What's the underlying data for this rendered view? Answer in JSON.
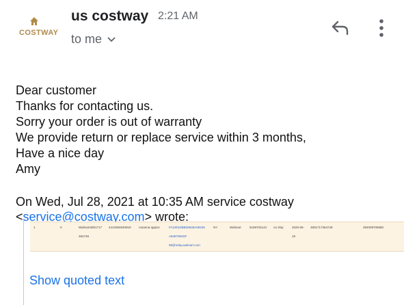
{
  "header": {
    "avatar_brand": "COSTWAY",
    "sender_name": "us costway",
    "time": "2:21 AM",
    "recipient": "to me",
    "icons": {
      "avatar": "costway-logo",
      "reply": "reply-icon",
      "more": "more-vert-icon",
      "expand": "chevron-down-icon"
    }
  },
  "message": {
    "lines": [
      "Dear customer",
      "Thanks for contacting us.",
      "Sorry your order is out of warranty",
      "We provide return or replace service within 3 months,",
      "Have a nice day",
      "Amy"
    ]
  },
  "quote": {
    "intro_line": "On Wed, Jul 28, 2021 at 10:35 AM service costway",
    "email_open": "<",
    "email": "service@costway.com",
    "email_close": "> wrote:",
    "table_row": {
      "c1": "1",
      "c2": "0",
      "c3": "Walmart4801717",
      "c4": "4412084840919",
      "c5": "rosanna appice",
      "c6": "FA1001DBB28948A09106",
      "c7": "NY",
      "c8": "Walmart",
      "c9": "5169702143",
      "c10": "no ship",
      "c11": "2020-06-",
      "c12": "4801717364748",
      "c13": "394009706680",
      "c3b": "364748",
      "c6b": "A8487084SF",
      "c11b": "18",
      "c6c": "99@relay.walmart.com"
    },
    "show_quoted_label": "Show quoted text"
  },
  "colors": {
    "link": "#1a73e8",
    "brand": "#b08a4a",
    "quote_bg": "#fdf3e2"
  }
}
